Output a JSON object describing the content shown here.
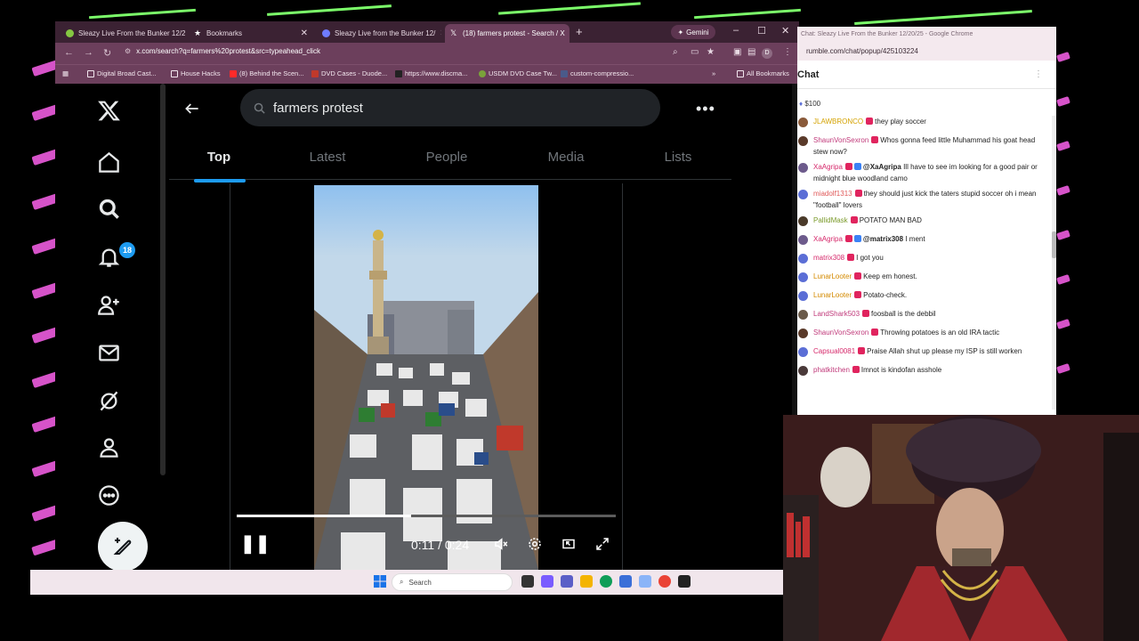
{
  "browser": {
    "tabs": [
      {
        "label": "Sleazy Live From the Bunker 12/2",
        "active": false,
        "icon": "rumble-icon"
      },
      {
        "label": "Bookmarks",
        "active": false,
        "icon": "star-icon"
      },
      {
        "label": "Sleazy Live from the Bunker 12/",
        "active": false,
        "icon": "rumble-icon"
      },
      {
        "label": "(18) farmers protest - Search / X",
        "active": true,
        "icon": "x-icon"
      }
    ],
    "gemini_label": "Gemini",
    "url": "x.com/search?q=farmers%20protest&src=typeahead_click",
    "profile_initial": "D",
    "bookmarks": [
      {
        "label": "Digital Broad Cast..."
      },
      {
        "label": "House Hacks"
      },
      {
        "label": "(8) Behind the Scen..."
      },
      {
        "label": "DVD Cases - Duode..."
      },
      {
        "label": "https://www.discma..."
      },
      {
        "label": "USDM DVD Case Tw..."
      },
      {
        "label": "custom-compressio..."
      }
    ],
    "all_bookmarks": "All Bookmarks"
  },
  "x": {
    "search_query": "farmers protest",
    "notification_count": "18",
    "tabs": [
      {
        "label": "Top",
        "selected": true
      },
      {
        "label": "Latest",
        "selected": false
      },
      {
        "label": "People",
        "selected": false
      },
      {
        "label": "Media",
        "selected": false
      },
      {
        "label": "Lists",
        "selected": false
      }
    ],
    "video": {
      "current_time": "0:11",
      "duration": "0:24",
      "time_display": "0:11 / 0:24",
      "progress_fraction": 0.46
    }
  },
  "chat": {
    "window_title": "Chat: Sleazy Live From the Bunker 12/20/25 - Google Chrome",
    "url": "rumble.com/chat/popup/425103224",
    "header": "Chat",
    "tip_amount": "$100",
    "messages": [
      {
        "user": "JLAWBRONCO",
        "color": "#d4a200",
        "avatar_color": "#8a5a3a",
        "text": "they play soccer",
        "mention": ""
      },
      {
        "user": "ShaunVonSexron",
        "color": "#c0397a",
        "avatar_color": "#5a3a2a",
        "text": "Whos gonna feed little Muhammad his goat head stew now?",
        "mention": ""
      },
      {
        "user": "XaAgripa",
        "color": "#d6296b",
        "avatar_color": "#6d5b8c",
        "text": "Ill have to see im looking for a good pair or midnight blue woodland camo",
        "mention": "@XaAgripa"
      },
      {
        "user": "miadolf1313",
        "color": "#e05a5a",
        "avatar_color": "#5b6ed6",
        "text": "they should just kick the taters stupid soccer oh i mean \"football\" lovers",
        "mention": ""
      },
      {
        "user": "PallidMask",
        "color": "#7a9a2a",
        "avatar_color": "#4a3a2a",
        "text": "POTATO MAN BAD",
        "mention": ""
      },
      {
        "user": "XaAgripa",
        "color": "#d6296b",
        "avatar_color": "#6d5b8c",
        "text": "I ment",
        "mention": "@matrix308"
      },
      {
        "user": "matrix308",
        "color": "#d6296b",
        "avatar_color": "#5b6ed6",
        "text": "I got you",
        "mention": ""
      },
      {
        "user": "LunarLooter",
        "color": "#d48a00",
        "avatar_color": "#5b6ed6",
        "text": "Keep em honest.",
        "mention": ""
      },
      {
        "user": "LunarLooter",
        "color": "#d48a00",
        "avatar_color": "#5b6ed6",
        "text": "Potato-check.",
        "mention": ""
      },
      {
        "user": "LandShark503",
        "color": "#c0397a",
        "avatar_color": "#6a5a4a",
        "text": "foosball is the debbil",
        "mention": ""
      },
      {
        "user": "ShaunVonSexron",
        "color": "#c0397a",
        "avatar_color": "#5a3a2a",
        "text": "Throwing potatoes is an old IRA tactic",
        "mention": ""
      },
      {
        "user": "Capsual0081",
        "color": "#d6296b",
        "avatar_color": "#5b6ed6",
        "text": "Praise Allah shut up please my ISP is still worken",
        "mention": ""
      },
      {
        "user": "phatkitchen",
        "color": "#c0397a",
        "avatar_color": "#4a3a3a",
        "text": "Imnot is kindofan asshole",
        "mention": ""
      }
    ]
  },
  "taskbar": {
    "search_placeholder": "Search"
  },
  "colors": {
    "x_blue": "#1d9bf0",
    "chrome_tab": "#6c3f5c",
    "stripe_pink": "#d653c9",
    "stripe_green": "#7cff6a"
  }
}
